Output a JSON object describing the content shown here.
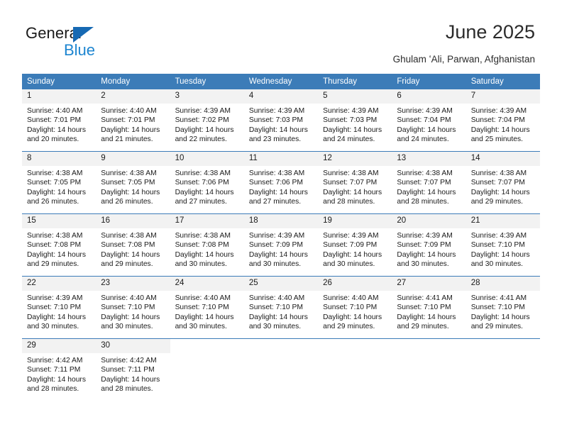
{
  "logo": {
    "word1": "General",
    "word2": "Blue",
    "triangle_color": "#1669b3",
    "blue_text_color": "#1d85d0"
  },
  "header": {
    "title": "June 2025",
    "subtitle": "Ghulam ʻAli, Parwan, Afghanistan"
  },
  "calendar": {
    "header_bg": "#3c7cb8",
    "daynum_bg": "#f2f2f2",
    "weekdays": [
      "Sunday",
      "Monday",
      "Tuesday",
      "Wednesday",
      "Thursday",
      "Friday",
      "Saturday"
    ],
    "weeks": [
      [
        {
          "day": "1",
          "sunrise": "Sunrise: 4:40 AM",
          "sunset": "Sunset: 7:01 PM",
          "daylight1": "Daylight: 14 hours",
          "daylight2": "and 20 minutes."
        },
        {
          "day": "2",
          "sunrise": "Sunrise: 4:40 AM",
          "sunset": "Sunset: 7:01 PM",
          "daylight1": "Daylight: 14 hours",
          "daylight2": "and 21 minutes."
        },
        {
          "day": "3",
          "sunrise": "Sunrise: 4:39 AM",
          "sunset": "Sunset: 7:02 PM",
          "daylight1": "Daylight: 14 hours",
          "daylight2": "and 22 minutes."
        },
        {
          "day": "4",
          "sunrise": "Sunrise: 4:39 AM",
          "sunset": "Sunset: 7:03 PM",
          "daylight1": "Daylight: 14 hours",
          "daylight2": "and 23 minutes."
        },
        {
          "day": "5",
          "sunrise": "Sunrise: 4:39 AM",
          "sunset": "Sunset: 7:03 PM",
          "daylight1": "Daylight: 14 hours",
          "daylight2": "and 24 minutes."
        },
        {
          "day": "6",
          "sunrise": "Sunrise: 4:39 AM",
          "sunset": "Sunset: 7:04 PM",
          "daylight1": "Daylight: 14 hours",
          "daylight2": "and 24 minutes."
        },
        {
          "day": "7",
          "sunrise": "Sunrise: 4:39 AM",
          "sunset": "Sunset: 7:04 PM",
          "daylight1": "Daylight: 14 hours",
          "daylight2": "and 25 minutes."
        }
      ],
      [
        {
          "day": "8",
          "sunrise": "Sunrise: 4:38 AM",
          "sunset": "Sunset: 7:05 PM",
          "daylight1": "Daylight: 14 hours",
          "daylight2": "and 26 minutes."
        },
        {
          "day": "9",
          "sunrise": "Sunrise: 4:38 AM",
          "sunset": "Sunset: 7:05 PM",
          "daylight1": "Daylight: 14 hours",
          "daylight2": "and 26 minutes."
        },
        {
          "day": "10",
          "sunrise": "Sunrise: 4:38 AM",
          "sunset": "Sunset: 7:06 PM",
          "daylight1": "Daylight: 14 hours",
          "daylight2": "and 27 minutes."
        },
        {
          "day": "11",
          "sunrise": "Sunrise: 4:38 AM",
          "sunset": "Sunset: 7:06 PM",
          "daylight1": "Daylight: 14 hours",
          "daylight2": "and 27 minutes."
        },
        {
          "day": "12",
          "sunrise": "Sunrise: 4:38 AM",
          "sunset": "Sunset: 7:07 PM",
          "daylight1": "Daylight: 14 hours",
          "daylight2": "and 28 minutes."
        },
        {
          "day": "13",
          "sunrise": "Sunrise: 4:38 AM",
          "sunset": "Sunset: 7:07 PM",
          "daylight1": "Daylight: 14 hours",
          "daylight2": "and 28 minutes."
        },
        {
          "day": "14",
          "sunrise": "Sunrise: 4:38 AM",
          "sunset": "Sunset: 7:07 PM",
          "daylight1": "Daylight: 14 hours",
          "daylight2": "and 29 minutes."
        }
      ],
      [
        {
          "day": "15",
          "sunrise": "Sunrise: 4:38 AM",
          "sunset": "Sunset: 7:08 PM",
          "daylight1": "Daylight: 14 hours",
          "daylight2": "and 29 minutes."
        },
        {
          "day": "16",
          "sunrise": "Sunrise: 4:38 AM",
          "sunset": "Sunset: 7:08 PM",
          "daylight1": "Daylight: 14 hours",
          "daylight2": "and 29 minutes."
        },
        {
          "day": "17",
          "sunrise": "Sunrise: 4:38 AM",
          "sunset": "Sunset: 7:08 PM",
          "daylight1": "Daylight: 14 hours",
          "daylight2": "and 30 minutes."
        },
        {
          "day": "18",
          "sunrise": "Sunrise: 4:39 AM",
          "sunset": "Sunset: 7:09 PM",
          "daylight1": "Daylight: 14 hours",
          "daylight2": "and 30 minutes."
        },
        {
          "day": "19",
          "sunrise": "Sunrise: 4:39 AM",
          "sunset": "Sunset: 7:09 PM",
          "daylight1": "Daylight: 14 hours",
          "daylight2": "and 30 minutes."
        },
        {
          "day": "20",
          "sunrise": "Sunrise: 4:39 AM",
          "sunset": "Sunset: 7:09 PM",
          "daylight1": "Daylight: 14 hours",
          "daylight2": "and 30 minutes."
        },
        {
          "day": "21",
          "sunrise": "Sunrise: 4:39 AM",
          "sunset": "Sunset: 7:10 PM",
          "daylight1": "Daylight: 14 hours",
          "daylight2": "and 30 minutes."
        }
      ],
      [
        {
          "day": "22",
          "sunrise": "Sunrise: 4:39 AM",
          "sunset": "Sunset: 7:10 PM",
          "daylight1": "Daylight: 14 hours",
          "daylight2": "and 30 minutes."
        },
        {
          "day": "23",
          "sunrise": "Sunrise: 4:40 AM",
          "sunset": "Sunset: 7:10 PM",
          "daylight1": "Daylight: 14 hours",
          "daylight2": "and 30 minutes."
        },
        {
          "day": "24",
          "sunrise": "Sunrise: 4:40 AM",
          "sunset": "Sunset: 7:10 PM",
          "daylight1": "Daylight: 14 hours",
          "daylight2": "and 30 minutes."
        },
        {
          "day": "25",
          "sunrise": "Sunrise: 4:40 AM",
          "sunset": "Sunset: 7:10 PM",
          "daylight1": "Daylight: 14 hours",
          "daylight2": "and 30 minutes."
        },
        {
          "day": "26",
          "sunrise": "Sunrise: 4:40 AM",
          "sunset": "Sunset: 7:10 PM",
          "daylight1": "Daylight: 14 hours",
          "daylight2": "and 29 minutes."
        },
        {
          "day": "27",
          "sunrise": "Sunrise: 4:41 AM",
          "sunset": "Sunset: 7:10 PM",
          "daylight1": "Daylight: 14 hours",
          "daylight2": "and 29 minutes."
        },
        {
          "day": "28",
          "sunrise": "Sunrise: 4:41 AM",
          "sunset": "Sunset: 7:10 PM",
          "daylight1": "Daylight: 14 hours",
          "daylight2": "and 29 minutes."
        }
      ],
      [
        {
          "day": "29",
          "sunrise": "Sunrise: 4:42 AM",
          "sunset": "Sunset: 7:11 PM",
          "daylight1": "Daylight: 14 hours",
          "daylight2": "and 28 minutes."
        },
        {
          "day": "30",
          "sunrise": "Sunrise: 4:42 AM",
          "sunset": "Sunset: 7:11 PM",
          "daylight1": "Daylight: 14 hours",
          "daylight2": "and 28 minutes."
        },
        {
          "day": "",
          "sunrise": "",
          "sunset": "",
          "daylight1": "",
          "daylight2": ""
        },
        {
          "day": "",
          "sunrise": "",
          "sunset": "",
          "daylight1": "",
          "daylight2": ""
        },
        {
          "day": "",
          "sunrise": "",
          "sunset": "",
          "daylight1": "",
          "daylight2": ""
        },
        {
          "day": "",
          "sunrise": "",
          "sunset": "",
          "daylight1": "",
          "daylight2": ""
        },
        {
          "day": "",
          "sunrise": "",
          "sunset": "",
          "daylight1": "",
          "daylight2": ""
        }
      ]
    ]
  }
}
